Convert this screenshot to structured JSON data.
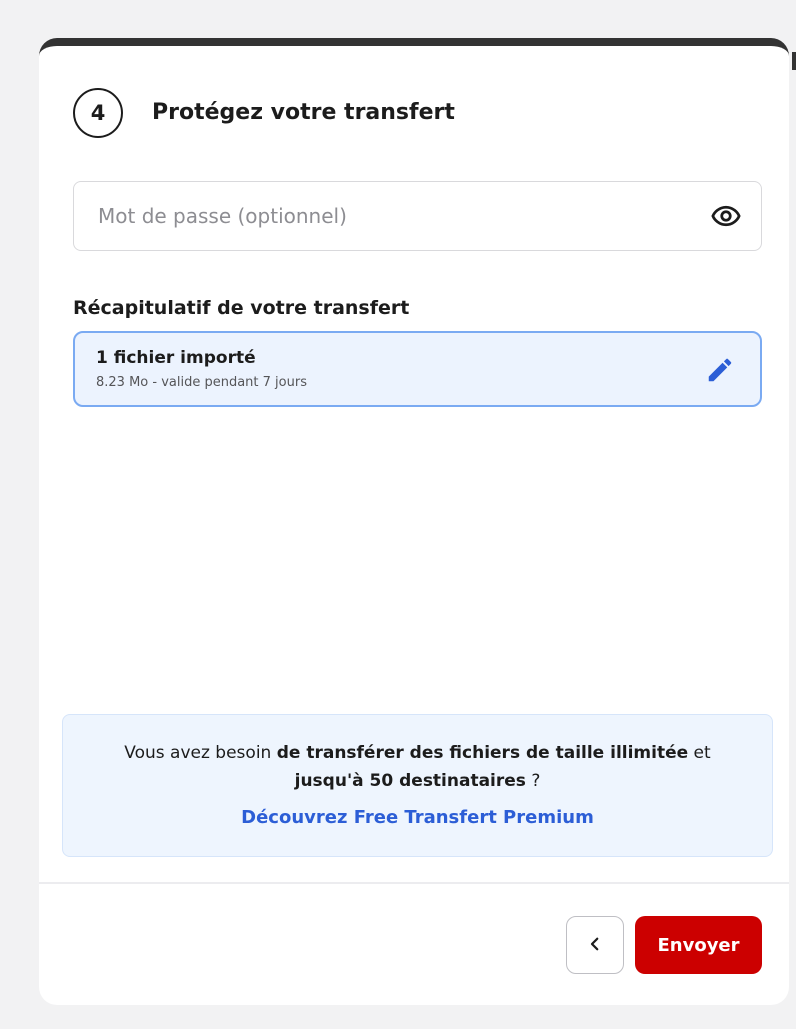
{
  "step": {
    "number": "4",
    "title": "Protégez votre transfert"
  },
  "password": {
    "placeholder": "Mot de passe (optionnel)",
    "value": "",
    "toggle_icon": "eye-icon"
  },
  "summary": {
    "heading": "Récapitulatif de votre transfert",
    "file_count": "1 fichier importé",
    "details": "8.23 Mo - valide pendant 7 jours",
    "edit_icon": "pencil-icon"
  },
  "promo": {
    "text_1": "Vous avez besoin ",
    "bold_1": "de transférer des fichiers de taille illimitée",
    "text_2": " et ",
    "bold_2": "jusqu'à 50 destinataires",
    "text_3": " ?",
    "link": "Découvrez Free Transfert Premium"
  },
  "footer": {
    "back_icon": "chevron-left-icon",
    "send_label": "Envoyer"
  },
  "colors": {
    "accent_red": "#cc0000",
    "link_blue": "#2c5ed6",
    "highlight_border": "#7aaaf2",
    "highlight_bg": "#ecf3fe",
    "promo_bg": "#eef5fe"
  }
}
